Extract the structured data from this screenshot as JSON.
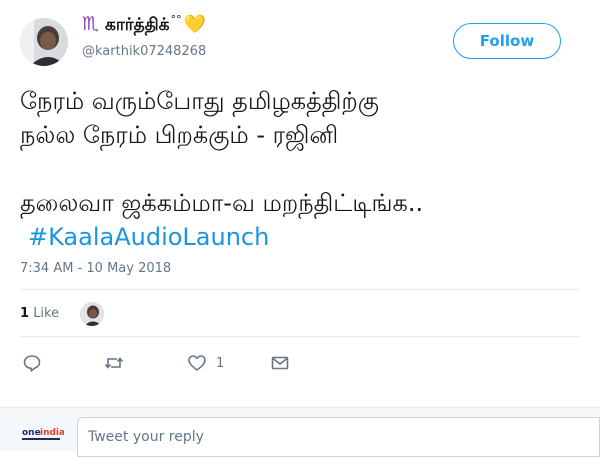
{
  "user": {
    "zodiac": "♏",
    "display_name": "கார்த்திக்",
    "name_suffix": "°°",
    "heart": "💛",
    "handle": "@karthik07248268"
  },
  "follow_button": {
    "label": "Follow"
  },
  "tweet": {
    "lines": [
      "நேரம் வரும்போது தமிழகத்திற்கு",
      "நல்ல நேரம் பிறக்கும் - ரஜினி",
      "தலைவா ஜக்கம்மா-வ மறந்திட்டிங்க.."
    ],
    "hashtag": "#KaalaAudioLaunch"
  },
  "timestamp": "7:34 AM - 10 May 2018",
  "stats": {
    "likes_count": "1",
    "likes_label": "Like"
  },
  "actions": {
    "reply_icon": "reply-icon",
    "retweet_icon": "retweet-icon",
    "like_icon": "heart-icon",
    "like_count": "1",
    "message_icon": "envelope-icon"
  },
  "reply": {
    "placeholder": "Tweet your reply"
  },
  "colors": {
    "accent": "#1da1f2",
    "hashtag": "#1b95e0",
    "muted": "#657786"
  }
}
